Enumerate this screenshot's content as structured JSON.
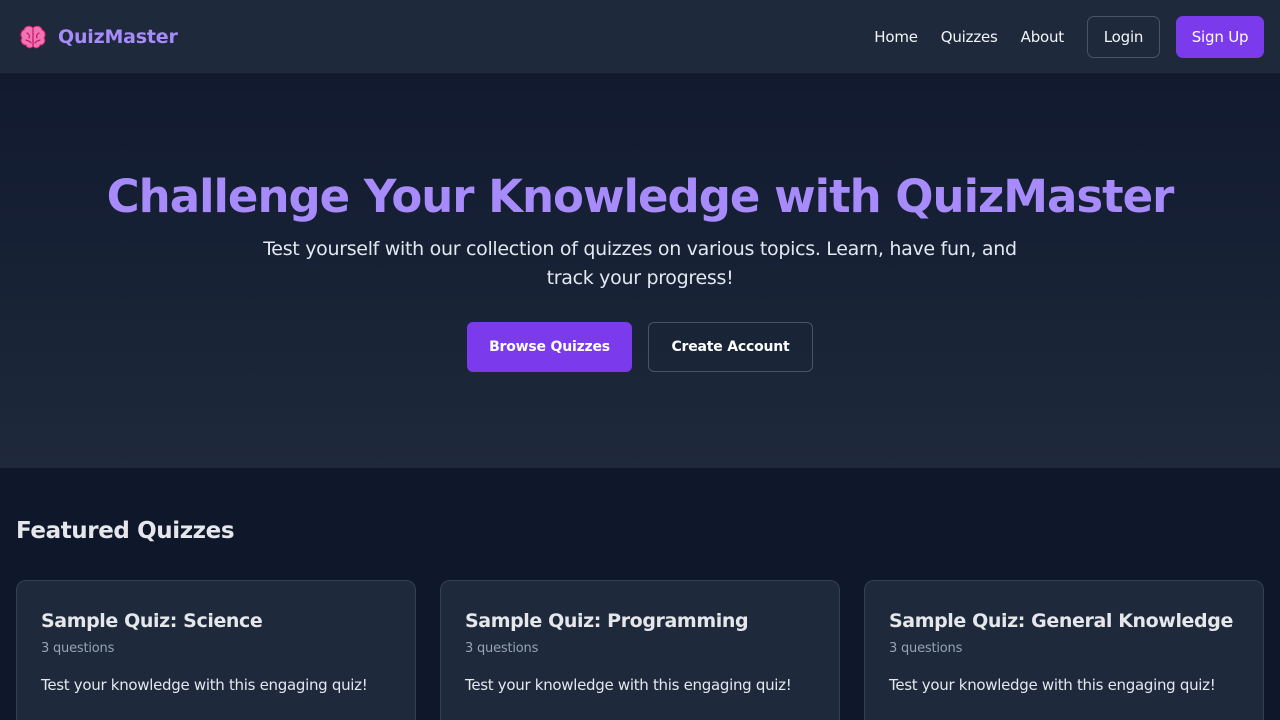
{
  "header": {
    "brand": "QuizMaster",
    "brand_icon": "brain-icon",
    "nav": [
      "Home",
      "Quizzes",
      "About"
    ],
    "login_label": "Login",
    "signup_label": "Sign Up"
  },
  "hero": {
    "title": "Challenge Your Knowledge with QuizMaster",
    "subtitle": "Test yourself with our collection of quizzes on various topics. Learn, have fun, and track your progress!",
    "browse_label": "Browse Quizzes",
    "create_label": "Create Account"
  },
  "featured": {
    "heading": "Featured Quizzes",
    "cards": [
      {
        "title": "Sample Quiz: Science",
        "count": "3 questions",
        "desc": "Test your knowledge with this engaging quiz!"
      },
      {
        "title": "Sample Quiz: Programming",
        "count": "3 questions",
        "desc": "Test your knowledge with this engaging quiz!"
      },
      {
        "title": "Sample Quiz: General Knowledge",
        "count": "3 questions",
        "desc": "Test your knowledge with this engaging quiz!"
      }
    ]
  },
  "colors": {
    "accent": "#7c3aed",
    "brand_text": "#a78bfa",
    "background": "#0f172a",
    "surface": "#1e293b",
    "icon_pink": "#ec4899"
  }
}
